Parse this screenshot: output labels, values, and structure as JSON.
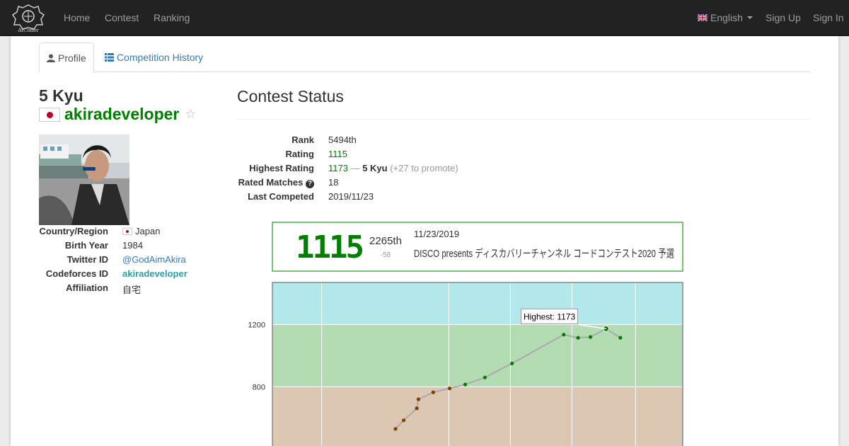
{
  "nav": {
    "logo_text": "AtCoder",
    "home": "Home",
    "contest": "Contest",
    "ranking": "Ranking",
    "language": "English",
    "sign_up": "Sign Up",
    "sign_in": "Sign In"
  },
  "tabs": {
    "profile": "Profile",
    "history": "Competition History"
  },
  "user": {
    "rank_title": "5 Kyu",
    "username": "akiradeveloper",
    "star": "☆"
  },
  "info": [
    {
      "label": "Country/Region",
      "value": "Japan"
    },
    {
      "label": "Birth Year",
      "value": "1984"
    },
    {
      "label": "Twitter ID",
      "value": "@GodAimAkira"
    },
    {
      "label": "Codeforces ID",
      "value": "akiradeveloper"
    },
    {
      "label": "Affiliation",
      "value": "自宅"
    }
  ],
  "status": {
    "title": "Contest Status",
    "rank_label": "Rank",
    "rank_value": "5494th",
    "rating_label": "Rating",
    "rating_value": "1115",
    "highest_label": "Highest Rating",
    "highest_value": "1173",
    "highest_sep": " — ",
    "highest_kyu": "5 Kyu",
    "highest_promote": " (+27 to promote)",
    "matches_label": "Rated Matches",
    "matches_value": "18",
    "last_label": "Last Competed",
    "last_value": "2019/11/23"
  },
  "colors": {
    "green": "#008000",
    "brown": "#804000",
    "cyan_band": "#b3e8eb",
    "green_band": "#b3dcb3",
    "brown_band": "#dcc7b3"
  },
  "chart_data": {
    "type": "line",
    "detail_card": {
      "rating": "1115",
      "place": "2265th",
      "diff": "-58",
      "date": "11/23/2019",
      "contest": "DISCO presents ディスカバリーチャンネル コードコンテスト2020 予選"
    },
    "tooltip": "Highest: 1173",
    "y_ticks": [
      1200,
      800
    ],
    "ylim": [
      400,
      1470
    ],
    "xlim": [
      0,
      1
    ],
    "points": [
      {
        "x": 0.3,
        "y": 530
      },
      {
        "x": 0.32,
        "y": 585
      },
      {
        "x": 0.352,
        "y": 662
      },
      {
        "x": 0.356,
        "y": 720
      },
      {
        "x": 0.392,
        "y": 765
      },
      {
        "x": 0.432,
        "y": 790
      },
      {
        "x": 0.47,
        "y": 815
      },
      {
        "x": 0.518,
        "y": 860
      },
      {
        "x": 0.584,
        "y": 950
      },
      {
        "x": 0.71,
        "y": 1135
      },
      {
        "x": 0.745,
        "y": 1115
      },
      {
        "x": 0.775,
        "y": 1120
      },
      {
        "x": 0.813,
        "y": 1173
      },
      {
        "x": 0.848,
        "y": 1115
      }
    ],
    "highest_index": 12
  }
}
